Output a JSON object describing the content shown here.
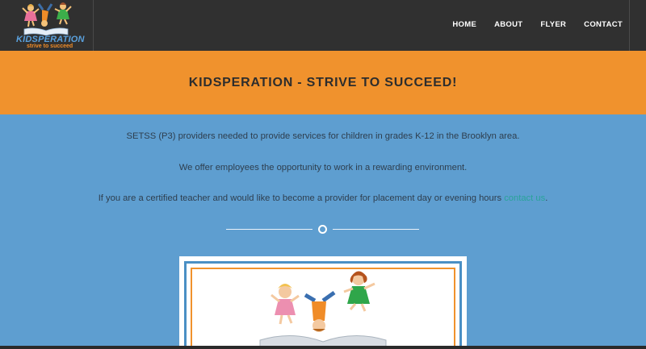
{
  "logo": {
    "name": "KIDSPERATION",
    "tagline": "strive to succeed"
  },
  "nav": {
    "items": [
      "HOME",
      "ABOUT",
      "FLYER",
      "CONTACT"
    ]
  },
  "hero": {
    "title": "KIDSPERATION - STRIVE TO SUCCEED!"
  },
  "content": {
    "p1": "SETSS (P3) providers needed to provide services for children in grades K-12 in the Brooklyn area.",
    "p2": "We offer employees the opportunity to work in a rewarding environment.",
    "p3": "If you are a certified teacher and would like to become a provider for placement day or evening hours ",
    "p3_link": "contact us",
    "p3_end": "."
  },
  "colors": {
    "header_bg": "#303030",
    "band": "#f0922d",
    "page_bg": "#5e9ed0",
    "link": "#2aa39a"
  }
}
